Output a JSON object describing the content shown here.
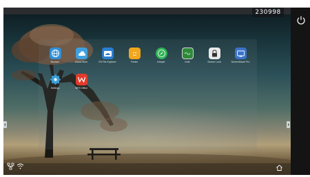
{
  "clock": "230998",
  "apps": [
    {
      "label": "Browser",
      "icon": "globe-icon",
      "color": "#2f8fd6"
    },
    {
      "label": "Cloud Drive",
      "icon": "cloud-icon",
      "color": "#3fa0e0"
    },
    {
      "label": "ES File Explorer",
      "icon": "folder-cloud-icon",
      "color": "#2b7fd0"
    },
    {
      "label": "Finder",
      "icon": "finder-icon",
      "color": "#f2a61c"
    },
    {
      "label": "Keeper",
      "icon": "compass-icon",
      "color": "#2fb455"
    },
    {
      "label": "Note",
      "icon": "board-icon",
      "color": "#2e8a3a"
    },
    {
      "label": "Screen Lock",
      "icon": "lock-icon",
      "color": "#e9e9e9"
    },
    {
      "label": "ScreenShare Pro",
      "icon": "screenshare-icon",
      "color": "#3a73c9"
    },
    {
      "label": "Settings",
      "icon": "gear-icon",
      "color": "#3da0d8"
    },
    {
      "label": "WPS Office",
      "icon": "wps-icon",
      "color": "#e23b2c"
    }
  ]
}
